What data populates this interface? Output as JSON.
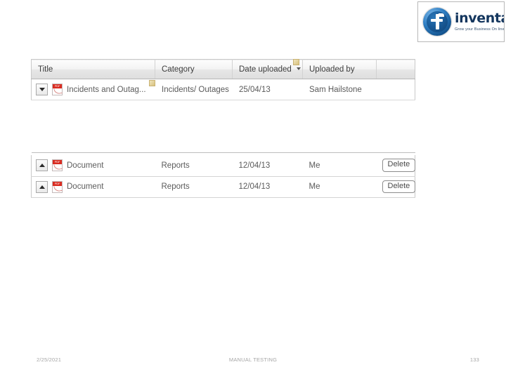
{
  "logo": {
    "name": "inventateq-logo",
    "wordmark": "inventateq",
    "tagline": "Grow your Business On line",
    "registered_mark": "®",
    "brand_color": "#14365e",
    "glyph_color": "#1a5c99"
  },
  "table_one": {
    "columns": [
      "Title",
      "Category",
      "Date uploaded",
      "Uploaded by",
      ""
    ],
    "sort_column": "Date uploaded",
    "sort_caret": "▾",
    "rows": [
      {
        "expander": "chevron-down",
        "file_icon": "pdf-icon",
        "file_icon_label": "PDF",
        "title": "Incidents and Outag...",
        "category": "Incidents/ Outages",
        "date_uploaded": "25/04/13",
        "uploaded_by": "Sam Hailstone"
      }
    ]
  },
  "table_two": {
    "rows": [
      {
        "expander": "chevron-up",
        "file_icon": "pdf-icon",
        "file_icon_label": "PDF",
        "title": "Document",
        "category": "Reports",
        "date_uploaded": "12/04/13",
        "uploaded_by": "Me",
        "action_label": "Delete"
      },
      {
        "expander": "chevron-up",
        "file_icon": "pdf-icon",
        "file_icon_label": "PDF",
        "title": "Document",
        "category": "Reports",
        "date_uploaded": "12/04/13",
        "uploaded_by": "Me",
        "action_label": "Delete"
      }
    ]
  },
  "markers": {
    "date_header_marker": "callout-marker",
    "title_cell_marker": "callout-marker",
    "marker_color": "#d8c27e"
  },
  "footer": {
    "date": "2/25/2021",
    "center": "MANUAL TESTING",
    "page": "133"
  }
}
